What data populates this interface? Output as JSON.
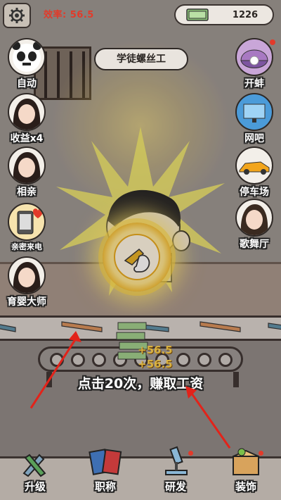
{
  "header": {
    "efficiency_label": "效率: 56.5",
    "money_value": "1226"
  },
  "job_title": "学徒螺丝工",
  "left_buttons": [
    {
      "label": "自动",
      "icon": "panda-face-icon"
    },
    {
      "label": "收益x4",
      "icon": "girl-avatar-icon"
    },
    {
      "label": "相亲",
      "icon": "girl-avatar-icon"
    },
    {
      "label": "亲密来电",
      "icon": "phone-heart-icon"
    },
    {
      "label": "育婴大师",
      "icon": "girl-avatar-icon"
    }
  ],
  "right_buttons": [
    {
      "label": "开蚌",
      "icon": "clam-pearl-icon"
    },
    {
      "label": "网吧",
      "icon": "computer-icon"
    },
    {
      "label": "停车场",
      "icon": "sports-car-icon"
    },
    {
      "label": "歌舞厅",
      "icon": "girl-avatar-icon"
    }
  ],
  "floating_earnings": [
    "+56.5",
    "+56.5"
  ],
  "instruction": "点击20次，赚取工资",
  "bottom_nav": [
    {
      "label": "升级",
      "icon": "wrench-screwdriver-icon"
    },
    {
      "label": "职称",
      "icon": "certificate-icon"
    },
    {
      "label": "研发",
      "icon": "microscope-icon"
    },
    {
      "label": "装饰",
      "icon": "gift-box-icon"
    }
  ],
  "colors": {
    "efficiency": "#e23a2a",
    "arrow": "#e2231a",
    "glow": "#ffd24a"
  }
}
